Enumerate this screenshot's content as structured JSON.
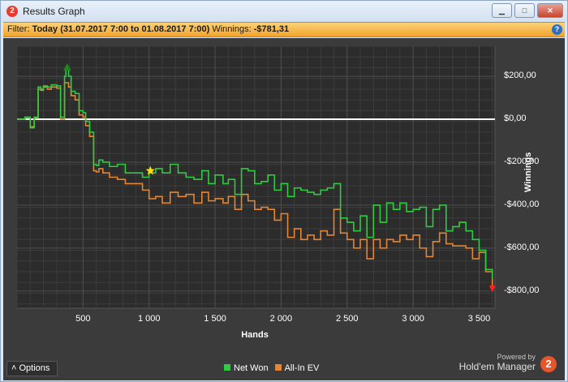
{
  "window": {
    "title": "Results Graph",
    "app_icon": "2",
    "minimize_glyph": "▁",
    "maximize_glyph": "□",
    "close_glyph": "✕"
  },
  "filter": {
    "label": "Filter:",
    "value": "Today (31.07.2017 7:00 to 01.08.2017 7:00)",
    "winnings_label": "Winnings:",
    "winnings_value": "-$781,31",
    "help_glyph": "?"
  },
  "footer": {
    "options_label": "Options",
    "options_glyph": "˄",
    "powered_by": "Powered by",
    "product": "Hold'em Manager",
    "logo_glyph": "2"
  },
  "chart_data": {
    "type": "line",
    "xlabel": "Hands",
    "ylabel": "Winnings",
    "xlim": [
      0,
      3620
    ],
    "ylim": [
      -880,
      340
    ],
    "x_ticks": [
      {
        "v": 500,
        "label": "500"
      },
      {
        "v": 1000,
        "label": "1 000"
      },
      {
        "v": 1500,
        "label": "1 500"
      },
      {
        "v": 2000,
        "label": "2 000"
      },
      {
        "v": 2500,
        "label": "2 500"
      },
      {
        "v": 3000,
        "label": "3 000"
      },
      {
        "v": 3500,
        "label": "3 500"
      }
    ],
    "y_ticks": [
      {
        "v": 200,
        "label": "$200,00"
      },
      {
        "v": 0,
        "label": "$0,00"
      },
      {
        "v": -200,
        "label": "-$200,00"
      },
      {
        "v": -400,
        "label": "-$400,00"
      },
      {
        "v": -600,
        "label": "-$600,00"
      },
      {
        "v": -800,
        "label": "-$800,00"
      }
    ],
    "grid": true,
    "legend_position": "bottom",
    "series": [
      {
        "name": "Net Won",
        "color": "#2ecc40",
        "x": [
          0,
          60,
          100,
          130,
          160,
          180,
          200,
          230,
          260,
          300,
          330,
          360,
          370,
          390,
          410,
          440,
          470,
          500,
          520,
          550,
          580,
          600,
          620,
          650,
          700,
          760,
          820,
          880,
          950,
          1000,
          1050,
          1100,
          1160,
          1220,
          1280,
          1340,
          1400,
          1450,
          1500,
          1560,
          1600,
          1650,
          1700,
          1750,
          1800,
          1850,
          1900,
          1950,
          2000,
          2050,
          2100,
          2150,
          2200,
          2250,
          2300,
          2350,
          2400,
          2450,
          2500,
          2550,
          2600,
          2650,
          2700,
          2750,
          2800,
          2850,
          2900,
          2950,
          3000,
          3050,
          3100,
          3150,
          3200,
          3250,
          3300,
          3350,
          3400,
          3450,
          3500,
          3550,
          3600
        ],
        "y": [
          0,
          10,
          -40,
          10,
          150,
          140,
          155,
          150,
          160,
          155,
          10,
          200,
          230,
          200,
          130,
          120,
          40,
          30,
          -10,
          -60,
          -210,
          -215,
          -190,
          -200,
          -220,
          -210,
          -250,
          -250,
          -270,
          -250,
          -230,
          -250,
          -210,
          -250,
          -270,
          -280,
          -240,
          -300,
          -260,
          -300,
          -280,
          -350,
          -230,
          -240,
          -300,
          -290,
          -260,
          -330,
          -300,
          -360,
          -320,
          -330,
          -340,
          -350,
          -330,
          -320,
          -300,
          -460,
          -480,
          -520,
          -450,
          -550,
          -400,
          -480,
          -390,
          -420,
          -390,
          -430,
          -420,
          -410,
          -500,
          -420,
          -400,
          -520,
          -500,
          -480,
          -520,
          -560,
          -610,
          -700,
          -740
        ]
      },
      {
        "name": "All-In EV",
        "color": "#e8852f",
        "x": [
          0,
          60,
          100,
          130,
          160,
          180,
          200,
          230,
          260,
          300,
          330,
          360,
          370,
          390,
          410,
          440,
          470,
          500,
          520,
          550,
          580,
          600,
          620,
          650,
          700,
          760,
          820,
          880,
          950,
          1000,
          1050,
          1100,
          1160,
          1220,
          1280,
          1340,
          1400,
          1450,
          1500,
          1560,
          1600,
          1650,
          1700,
          1750,
          1800,
          1850,
          1900,
          1950,
          2000,
          2050,
          2100,
          2150,
          2200,
          2250,
          2300,
          2350,
          2400,
          2450,
          2500,
          2550,
          2600,
          2650,
          2700,
          2750,
          2800,
          2850,
          2900,
          2950,
          3000,
          3050,
          3100,
          3150,
          3200,
          3250,
          3300,
          3350,
          3400,
          3450,
          3500,
          3550,
          3600
        ],
        "y": [
          0,
          8,
          -35,
          5,
          140,
          135,
          150,
          140,
          150,
          145,
          0,
          170,
          170,
          150,
          110,
          90,
          20,
          10,
          -30,
          -80,
          -240,
          -245,
          -230,
          -250,
          -270,
          -280,
          -300,
          -300,
          -330,
          -370,
          -360,
          -390,
          -340,
          -360,
          -350,
          -390,
          -340,
          -380,
          -370,
          -390,
          -360,
          -420,
          -350,
          -380,
          -420,
          -410,
          -420,
          -470,
          -440,
          -550,
          -510,
          -560,
          -540,
          -560,
          -520,
          -540,
          -420,
          -530,
          -560,
          -600,
          -560,
          -650,
          -560,
          -600,
          -560,
          -570,
          -540,
          -560,
          -540,
          -600,
          -640,
          -570,
          -530,
          -580,
          -590,
          -590,
          -600,
          -650,
          -620,
          -710,
          -780
        ]
      }
    ],
    "markers": [
      {
        "name": "max",
        "x": 380,
        "y": 245,
        "color": "#1b8a1b"
      },
      {
        "name": "star",
        "x": 1010,
        "y": -240,
        "color": "#ffe000"
      },
      {
        "name": "min",
        "x": 3600,
        "y": -790,
        "color": "#ff2020"
      }
    ],
    "reference_line_y": 0
  }
}
